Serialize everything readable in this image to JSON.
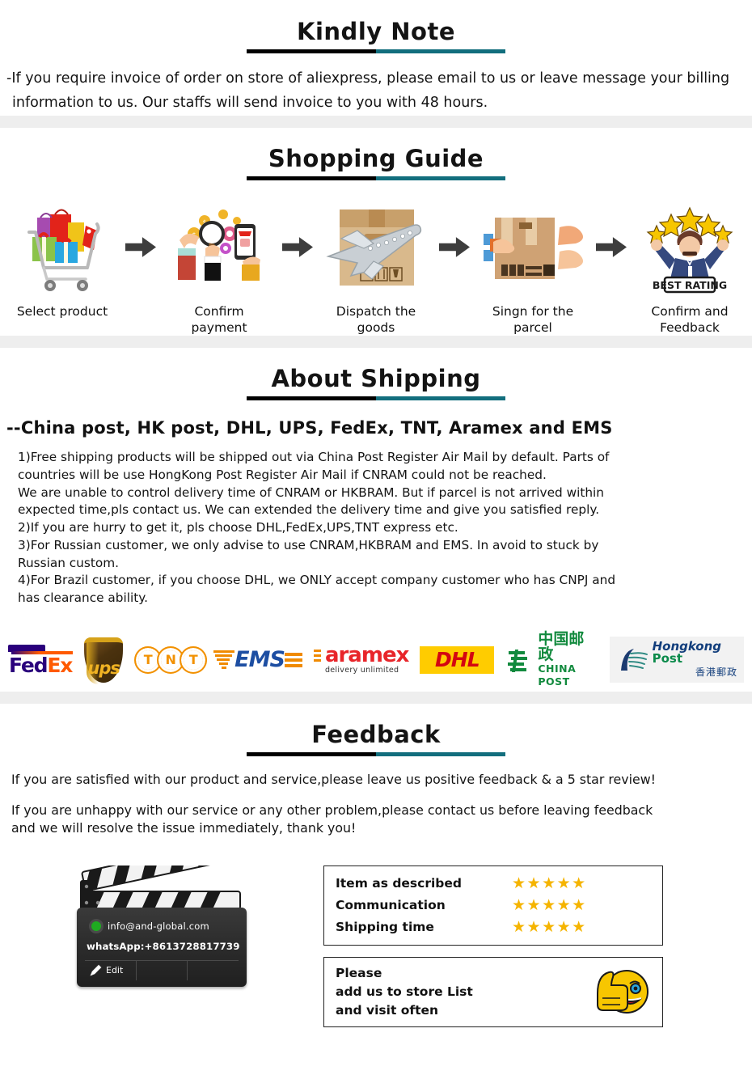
{
  "theme": {
    "accent_teal": "#126e7d",
    "rule_dark": "#000000",
    "band_gray": "#eeeeee",
    "star_gold": "#f5b400"
  },
  "kindly_note": {
    "title": "Kindly Note",
    "line1": "-If you require invoice of order on store of aliexpress, please email to us or leave message your billing",
    "line2": "information to us. Our staffs will send invoice to you with 48 hours."
  },
  "shopping_guide": {
    "title": "Shopping  Guide",
    "steps": [
      {
        "icon": "shopping-cart-icon",
        "label": "Select product"
      },
      {
        "icon": "payment-hands-icon",
        "label": "Confirm payment"
      },
      {
        "icon": "airplane-parcel-icon",
        "label": "Dispatch the goods"
      },
      {
        "icon": "parcel-handover-icon",
        "label": "Singn for the parcel"
      },
      {
        "icon": "best-rating-icon",
        "label": "Confirm and Feedback"
      }
    ],
    "best_rating_badge": "BEST RATING"
  },
  "about_shipping": {
    "title": "About Shipping",
    "carriers_headline": "--China post, HK post, DHL, UPS, FedEx, TNT, Aramex and EMS",
    "notes": [
      "1)Free shipping products will be shipped out via China Post Register Air Mail by default. Parts of",
      "countries will be use HongKong Post Register Air Mail if CNRAM could not be reached.",
      "We are unable to control delivery time of CNRAM or HKBRAM. But if parcel is not arrived within",
      "expected time,pls contact us. We can extended the delivery time and give you satisfied reply.",
      "2)If you are hurry to get it, pls choose DHL,FedEx,UPS,TNT express etc.",
      "3)For Russian customer, we only advise to use CNRAM,HKBRAM and EMS. In avoid to stuck by",
      "Russian custom.",
      "4)For Brazil customer, if you choose DHL, we ONLY accept company customer who has CNPJ and",
      "has clearance ability."
    ],
    "logos": [
      {
        "name": "fedex-logo",
        "fed": "Fed",
        "ex": "Ex"
      },
      {
        "name": "ups-logo",
        "text": "ups"
      },
      {
        "name": "tnt-logo",
        "letters": [
          "T",
          "N",
          "T"
        ]
      },
      {
        "name": "ems-logo",
        "text": "EMS"
      },
      {
        "name": "aramex-logo",
        "text": "aramex",
        "sub": "delivery unlimited"
      },
      {
        "name": "dhl-logo",
        "text": "DHL"
      },
      {
        "name": "china-post-logo",
        "cn": "中国邮政",
        "en": "CHINA POST"
      },
      {
        "name": "hongkong-post-logo",
        "en1": "Hongkong",
        "en2": "Post",
        "cn": "香港郵政"
      }
    ]
  },
  "feedback": {
    "title": "Feedback",
    "paragraph1": "If you are satisfied with our product and service,please leave us positive feedback & a 5 star review!",
    "paragraph2_line1": "If you are unhappy with our service or any other problem,please contact us before leaving feedback",
    "paragraph2_line2": "and we will resolve the issue immediately, thank you!"
  },
  "contact_card": {
    "email": "info@and-global.com",
    "whatsapp": "whatsApp:+8613728817739",
    "edit_label": "Edit"
  },
  "rating_box": {
    "rows": [
      {
        "label": "Item as described",
        "stars": "★★★★★",
        "value": 5
      },
      {
        "label": "Communication",
        "stars": "★★★★★",
        "value": 5
      },
      {
        "label": "Shipping time",
        "stars": "★★★★★",
        "value": 5
      }
    ]
  },
  "please_box": {
    "line1": "Please",
    "line2": "add us to store List",
    "line3": "and visit often"
  }
}
